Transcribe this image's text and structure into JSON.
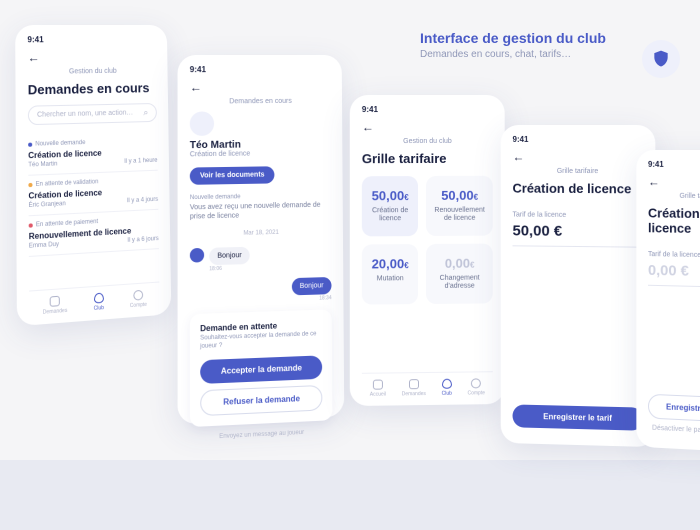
{
  "header": {
    "title": "Interface de gestion du club",
    "subtitle": "Demandes en cours, chat, tarifs…"
  },
  "time": "9:41",
  "crumbs": {
    "club": "Gestion du club",
    "requests": "Demandes en cours",
    "pricing": "Grille tarifaire"
  },
  "p1": {
    "title": "Demandes en cours",
    "search_placeholder": "Chercher un nom, une action…",
    "items": [
      {
        "status": "Nouvelle demande",
        "title": "Création de licence",
        "who": "Téo Martin",
        "when": "Il y a 1 heure"
      },
      {
        "status": "En attente de validation",
        "title": "Création de licence",
        "who": "Éric Granjean",
        "when": "Il y a 4 jours"
      },
      {
        "status": "En attente de paiement",
        "title": "Renouvellement de licence",
        "who": "Emma Duy",
        "when": "Il y a 6 jours"
      }
    ],
    "tabs": [
      "Demandes",
      "Club",
      "Compte"
    ]
  },
  "p2": {
    "name": "Téo Martin",
    "subtitle": "Création de licence",
    "docs_btn": "Voir les documents",
    "new_label": "Nouvelle demande",
    "new_text": "Vous avez reçu une nouvelle demande de prise de licence",
    "date": "Mar 18, 2021",
    "msg_left": "Bonjour",
    "msg_left_time": "18:06",
    "msg_right": "Bonjour",
    "msg_right_time": "18:34",
    "action_title": "Demande en attente",
    "action_sub": "Souhaitez-vous accepter la demande de ce joueur ?",
    "accept": "Accepter la demande",
    "refuse": "Refuser la demande",
    "compose": "Envoyez un message au joueur"
  },
  "p3": {
    "title": "Grille tarifaire",
    "cards": [
      {
        "price": "50,00",
        "label": "Création de licence"
      },
      {
        "price": "50,00",
        "label": "Renouvellement de licence"
      },
      {
        "price": "20,00",
        "label": "Mutation"
      },
      {
        "price": "0,00",
        "label": "Changement d'adresse"
      }
    ],
    "tabs": [
      "Accueil",
      "Demandes",
      "Club",
      "Compte"
    ]
  },
  "p4": {
    "title": "Création de licence",
    "field_label": "Tarif de la licence",
    "value": "50,00",
    "save": "Enregistrer le tarif"
  },
  "p5": {
    "title": "Création de licence",
    "field_label": "Tarif de la licence",
    "value": "0,00",
    "save": "Enregistrer le tarif",
    "disable": "Désactiver le paiement en ligne"
  },
  "currency": "€"
}
